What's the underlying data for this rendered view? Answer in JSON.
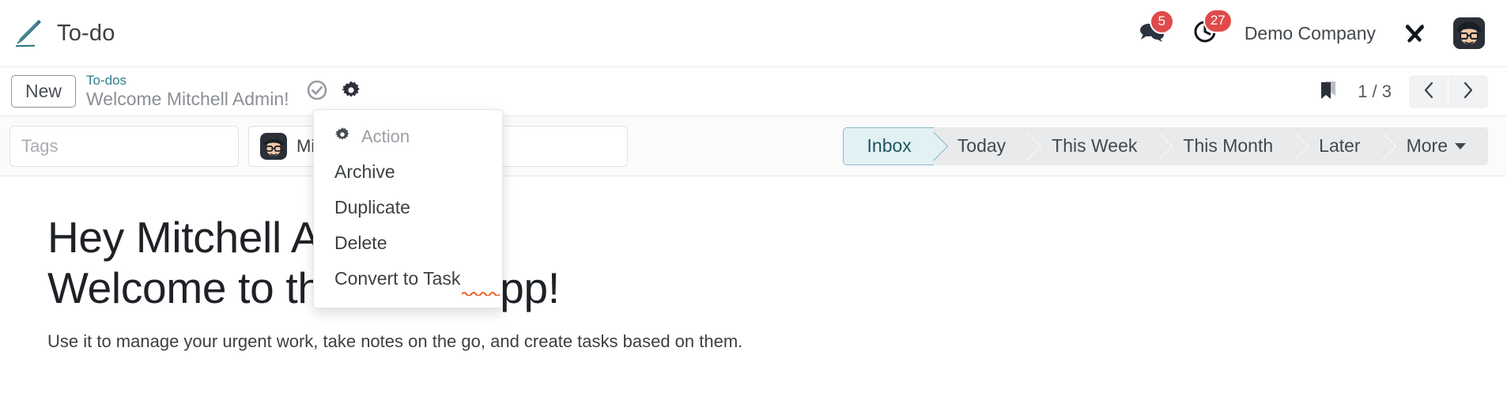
{
  "app": {
    "logo_icon": "pen-icon",
    "title": "To-do"
  },
  "navbar": {
    "messages": {
      "icon": "chat-bubbles-icon",
      "count": "5"
    },
    "activities": {
      "icon": "clock-icon",
      "count": "27"
    },
    "company": "Demo Company",
    "tools_icon": "tools-icon",
    "avatar_icon": "user-avatar"
  },
  "control_panel": {
    "new_label": "New",
    "breadcrumb_link": "To-dos",
    "record_name": "Welcome Mitchell Admin!",
    "saved_icon": "check-circle-icon",
    "gear_icon": "gear-icon",
    "bookmark_icon": "bookmark-icon",
    "pager": "1 / 3",
    "prev_icon": "chevron-left-icon",
    "next_icon": "chevron-right-icon"
  },
  "search": {
    "tags_placeholder": "Tags",
    "user_value": "Mit",
    "user_avatar_icon": "user-avatar"
  },
  "filters": {
    "items": [
      {
        "label": "Inbox",
        "active": true
      },
      {
        "label": "Today",
        "active": false
      },
      {
        "label": "This Week",
        "active": false
      },
      {
        "label": "This Month",
        "active": false
      },
      {
        "label": "Later",
        "active": false
      },
      {
        "label": "More",
        "active": false,
        "caret": true
      }
    ]
  },
  "dropdown": {
    "header_label": "Action",
    "header_icon": "gear-icon",
    "items": [
      {
        "label": "Archive"
      },
      {
        "label": "Duplicate"
      },
      {
        "label": "Delete"
      },
      {
        "label": "Convert to Task"
      }
    ]
  },
  "document": {
    "title_line1": "Hey Mitchell Admin,",
    "title_line2": "Welcome to the To-do app!",
    "body": "Use it to manage your urgent work, take notes on the go, and create tasks based on them."
  },
  "colors": {
    "accent_teal": "#2e7d8c",
    "badge_red": "#e04a4a",
    "active_filter_bg": "#e2f1f3",
    "spellcheck_red": "#e8622a"
  }
}
